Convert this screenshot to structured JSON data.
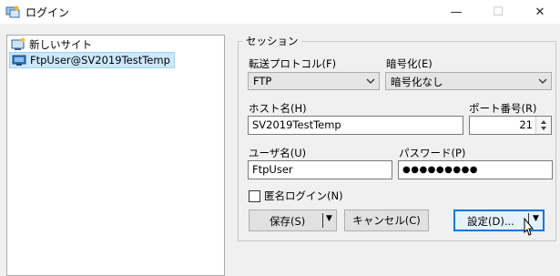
{
  "window": {
    "title": "ログイン",
    "controls": {
      "minimize": "—",
      "maximize": "☐",
      "close": "✕"
    }
  },
  "site_tree": {
    "items": [
      {
        "label": "新しいサイト",
        "icon": "new-site-icon",
        "selected": false
      },
      {
        "label": "FtpUser@SV2019TestTemp",
        "icon": "stored-site-icon",
        "selected": true
      }
    ]
  },
  "session": {
    "legend": "セッション",
    "protocol_label": "転送プロトコル(F)",
    "protocol_value": "FTP",
    "encryption_label": "暗号化(E)",
    "encryption_value": "暗号化なし",
    "host_label": "ホスト名(H)",
    "host_value": "SV2019TestTemp",
    "port_label": "ポート番号(R)",
    "port_value": "21",
    "user_label": "ユーザ名(U)",
    "user_value": "FtpUser",
    "password_label": "パスワード(P)",
    "password_value": "●●●●●●●●●",
    "anonymous_label": "匿名ログイン(N)",
    "anonymous_checked": false
  },
  "buttons": {
    "save": "保存(S)",
    "cancel": "キャンセル(C)",
    "settings": "設定(D)...",
    "dropdown_arrow": "▼"
  },
  "colors": {
    "selection": "#cce8ff",
    "focus_border": "#0078d7",
    "window_bg": "#f0f0f0"
  }
}
